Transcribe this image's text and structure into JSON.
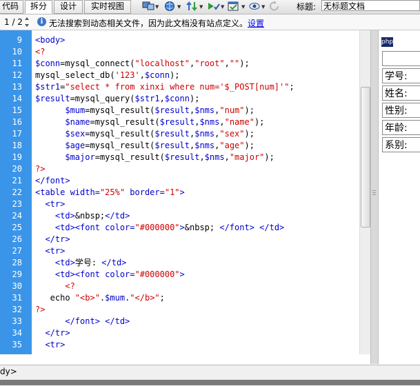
{
  "toolbar": {
    "btn_code": "代码",
    "btn_split": "拆分",
    "btn_design": "设计",
    "btn_live": "实时视图",
    "title_label": "标题:",
    "title_value": "无标题文档",
    "icons": [
      "multiscreen-icon",
      "globe-icon",
      "file-transfer-icon",
      "check-browser-icon",
      "view-options-icon",
      "visual-aids-icon",
      "refresh-icon"
    ]
  },
  "infobar": {
    "pager": "1 / 2",
    "message": "无法搜索到动态相关文件，因为此文档没有站点定义。",
    "link": "设置"
  },
  "editor": {
    "lines": [
      {
        "n": "9",
        "segs": [
          [
            "tag",
            "<body>"
          ]
        ]
      },
      {
        "n": "10",
        "segs": [
          [
            "php",
            "<?"
          ]
        ]
      },
      {
        "n": "11",
        "segs": [
          [
            "var",
            "$conn"
          ],
          [
            "txt",
            "=mysql_connect("
          ],
          [
            "str",
            "\"localhost\""
          ],
          [
            "txt",
            ","
          ],
          [
            "str",
            "\"root\""
          ],
          [
            "txt",
            ","
          ],
          [
            "str",
            "\"\""
          ],
          [
            "txt",
            ");"
          ]
        ]
      },
      {
        "n": "12",
        "segs": [
          [
            "txt",
            "mysql_select_db("
          ],
          [
            "str",
            "'123'"
          ],
          [
            "txt",
            ","
          ],
          [
            "var",
            "$conn"
          ],
          [
            "txt",
            ");"
          ]
        ]
      },
      {
        "n": "13",
        "segs": [
          [
            "var",
            "$str1"
          ],
          [
            "txt",
            "="
          ],
          [
            "str",
            "\"select * from xinxi where num='$_POST[num]'\""
          ],
          [
            "txt",
            ";"
          ]
        ]
      },
      {
        "n": "14",
        "segs": [
          [
            "var",
            "$result"
          ],
          [
            "txt",
            "=mysql_query("
          ],
          [
            "var",
            "$str1"
          ],
          [
            "txt",
            ","
          ],
          [
            "var",
            "$conn"
          ],
          [
            "txt",
            ");"
          ]
        ]
      },
      {
        "n": "15",
        "segs": [
          [
            "txt",
            "      "
          ],
          [
            "var",
            "$mum"
          ],
          [
            "txt",
            "=mysql_result("
          ],
          [
            "var",
            "$result"
          ],
          [
            "txt",
            ","
          ],
          [
            "var",
            "$nms"
          ],
          [
            "txt",
            ","
          ],
          [
            "str",
            "\"num\""
          ],
          [
            "txt",
            ");"
          ]
        ]
      },
      {
        "n": "16",
        "segs": [
          [
            "txt",
            "      "
          ],
          [
            "var",
            "$name"
          ],
          [
            "txt",
            "=mysql_result("
          ],
          [
            "var",
            "$result"
          ],
          [
            "txt",
            ","
          ],
          [
            "var",
            "$nms"
          ],
          [
            "txt",
            ","
          ],
          [
            "str",
            "\"name\""
          ],
          [
            "txt",
            ");"
          ]
        ]
      },
      {
        "n": "17",
        "segs": [
          [
            "txt",
            "      "
          ],
          [
            "var",
            "$sex"
          ],
          [
            "txt",
            "=mysql_result("
          ],
          [
            "var",
            "$result"
          ],
          [
            "txt",
            ","
          ],
          [
            "var",
            "$nms"
          ],
          [
            "txt",
            ","
          ],
          [
            "str",
            "\"sex\""
          ],
          [
            "txt",
            ");"
          ]
        ]
      },
      {
        "n": "18",
        "segs": [
          [
            "txt",
            "      "
          ],
          [
            "var",
            "$age"
          ],
          [
            "txt",
            "=mysql_result("
          ],
          [
            "var",
            "$result"
          ],
          [
            "txt",
            ","
          ],
          [
            "var",
            "$nms"
          ],
          [
            "txt",
            ","
          ],
          [
            "str",
            "\"age\""
          ],
          [
            "txt",
            ");"
          ]
        ]
      },
      {
        "n": "19",
        "segs": [
          [
            "txt",
            "      "
          ],
          [
            "var",
            "$major"
          ],
          [
            "txt",
            "=mysql_result("
          ],
          [
            "var",
            "$result"
          ],
          [
            "txt",
            ","
          ],
          [
            "var",
            "$nms"
          ],
          [
            "txt",
            ","
          ],
          [
            "str",
            "\"major\""
          ],
          [
            "txt",
            ");"
          ]
        ]
      },
      {
        "n": "20",
        "segs": [
          [
            "php",
            "?>"
          ]
        ]
      },
      {
        "n": "21",
        "segs": [
          [
            "tag",
            "</font>"
          ]
        ]
      },
      {
        "n": "22",
        "segs": [
          [
            "tag",
            "<table width="
          ],
          [
            "str",
            "\"25%\""
          ],
          [
            "tag",
            " border="
          ],
          [
            "str",
            "\"1\""
          ],
          [
            "tag",
            ">"
          ]
        ]
      },
      {
        "n": "23",
        "segs": [
          [
            "txt",
            "  "
          ],
          [
            "tag",
            "<tr>"
          ]
        ]
      },
      {
        "n": "24",
        "segs": [
          [
            "txt",
            "    "
          ],
          [
            "tag",
            "<td>"
          ],
          [
            "ent",
            "&nbsp;"
          ],
          [
            "tag",
            "</td>"
          ]
        ]
      },
      {
        "n": "25",
        "segs": [
          [
            "txt",
            "    "
          ],
          [
            "tag",
            "<td><font color="
          ],
          [
            "str",
            "\"#000000\""
          ],
          [
            "tag",
            ">"
          ],
          [
            "ent",
            "&nbsp; "
          ],
          [
            "tag",
            "</font> </td>"
          ]
        ]
      },
      {
        "n": "26",
        "segs": [
          [
            "txt",
            "  "
          ],
          [
            "tag",
            "</tr>"
          ]
        ]
      },
      {
        "n": "27",
        "segs": [
          [
            "txt",
            "  "
          ],
          [
            "tag",
            "<tr>"
          ]
        ]
      },
      {
        "n": "28",
        "segs": [
          [
            "txt",
            "    "
          ],
          [
            "tag",
            "<td>"
          ],
          [
            "txt",
            "学号: "
          ],
          [
            "tag",
            "</td>"
          ]
        ]
      },
      {
        "n": "29",
        "segs": [
          [
            "txt",
            "    "
          ],
          [
            "tag",
            "<td><font color="
          ],
          [
            "str",
            "\"#000000\""
          ],
          [
            "tag",
            ">"
          ]
        ]
      },
      {
        "n": "30",
        "segs": [
          [
            "txt",
            "      "
          ],
          [
            "php",
            "<?"
          ]
        ]
      },
      {
        "n": "31",
        "segs": [
          [
            "txt",
            "   echo "
          ],
          [
            "str",
            "\"<b>\""
          ],
          [
            "txt",
            "."
          ],
          [
            "var",
            "$mum"
          ],
          [
            "txt",
            "."
          ],
          [
            "str",
            "\"</b>\""
          ],
          [
            "txt",
            ";"
          ]
        ]
      },
      {
        "n": "32",
        "segs": [
          [
            "php",
            "?>"
          ]
        ]
      },
      {
        "n": "33",
        "segs": [
          [
            "txt",
            "      "
          ],
          [
            "tag",
            "</font> </td>"
          ]
        ]
      },
      {
        "n": "34",
        "segs": [
          [
            "txt",
            "  "
          ],
          [
            "tag",
            "</tr>"
          ]
        ]
      },
      {
        "n": "35",
        "segs": [
          [
            "txt",
            "  "
          ],
          [
            "tag",
            "<tr>"
          ]
        ]
      }
    ]
  },
  "design": {
    "php_badge": "php",
    "fields": [
      "",
      "学号:",
      "姓名:",
      "性别:",
      "年龄:",
      "系别:"
    ]
  },
  "status": {
    "tag_selector": "dy>"
  }
}
